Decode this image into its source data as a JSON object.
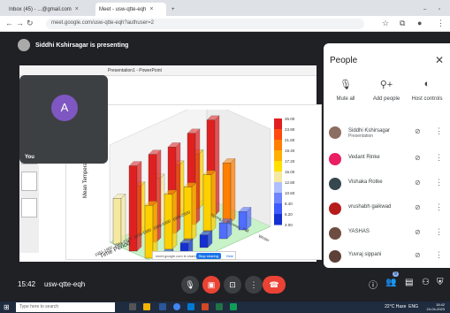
{
  "browser": {
    "tabs": [
      {
        "label": "Inbox (45) - ...@gmail.com",
        "active": false
      },
      {
        "label": "Meet - usw-qtte-eqh",
        "active": true
      }
    ],
    "url": "meet.google.com/usw-qtte-eqh?authuser=2"
  },
  "presenter": {
    "text": "Siddhi Kshirsagar is presenting"
  },
  "shared_window": {
    "title": "Presentation1 - PowerPoint",
    "share_banner": "meet.google.com is sharing a window.",
    "stop_label": "Stop sharing",
    "hide_label": "Hide"
  },
  "you_tile": {
    "initial": "A",
    "label": "You",
    "avatar_color": "#7e57c2"
  },
  "people": {
    "title": "People",
    "actions": [
      {
        "label": "Mute all",
        "icon": "mic-off-icon"
      },
      {
        "label": "Add people",
        "icon": "add-person-icon"
      },
      {
        "label": "Host controls",
        "icon": "toggle-icon"
      }
    ],
    "participants": [
      {
        "name": "Siddhi Kshirsagar",
        "sub": "Presentation",
        "color": "#8d6e63"
      },
      {
        "name": "Vedant Rinke",
        "sub": "",
        "color": "#e91e63"
      },
      {
        "name": "Vishaka Rotke",
        "sub": "",
        "color": "#37474f"
      },
      {
        "name": "vrushabh gaikwad",
        "sub": "",
        "color": "#b71c1c"
      },
      {
        "name": "YASHAS",
        "sub": "",
        "color": "#6d4c41"
      },
      {
        "name": "Yuvraj sippani",
        "sub": "",
        "color": "#5d4037"
      }
    ]
  },
  "meetbar": {
    "time": "15:42",
    "code": "usw-qtte-eqh",
    "people_count": "9"
  },
  "taskbar": {
    "search_placeholder": "Type here to search",
    "temp": "22°C Haze",
    "lang": "ENG",
    "time": "15:42",
    "date": "24-04-2023"
  },
  "chart_data": {
    "type": "bar",
    "title": "",
    "xlabel": "Time Period",
    "ylabel": "Mean Temperature (deg C)",
    "categories": [
      "1951-1960",
      "1961-1970",
      "1971-1980",
      "1981-1990",
      "1991-2000"
    ],
    "series": [
      {
        "name": "Spring",
        "values": [
          12.2,
          13.1,
          12.8,
          14.0,
          14.6
        ]
      },
      {
        "name": "Summer",
        "values": [
          22.8,
          23.5,
          23.1,
          24.4,
          25.6
        ]
      },
      {
        "name": "Fall",
        "values": [
          14.1,
          14.7,
          14.3,
          15.2,
          16.0
        ]
      },
      {
        "name": "Winter",
        "values": [
          3.1,
          3.6,
          3.4,
          4.2,
          4.9
        ]
      }
    ],
    "colorbar_ticks": [
      "26.00",
      "23.80",
      "21.60",
      "19.40",
      "17.20",
      "15.00",
      "12.80",
      "10.60",
      "8.40",
      "6.20",
      "4.00"
    ],
    "ylim": [
      0,
      26
    ]
  }
}
